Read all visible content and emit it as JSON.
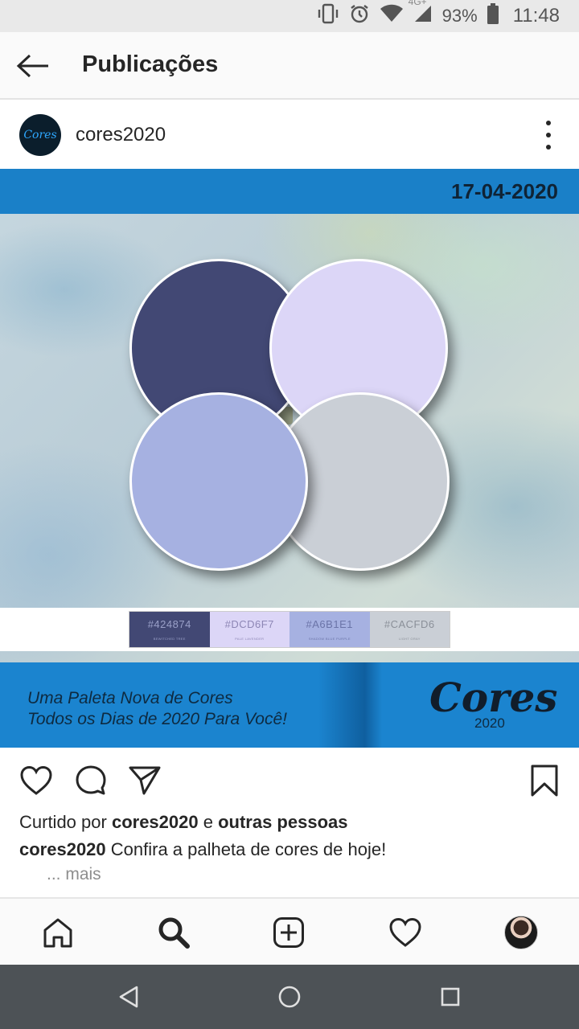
{
  "status_bar": {
    "battery": "93%",
    "time": "11:48",
    "network": "4G+"
  },
  "header": {
    "title": "Publicações"
  },
  "post": {
    "username": "cores2020",
    "avatar_logo_text": "Cores",
    "date": "17-04-2020",
    "palette": [
      {
        "hex": "#424874",
        "name": "BEWITCHED TREE",
        "text_color": "#9aa0c8"
      },
      {
        "hex": "#DCD6F7",
        "name": "PALE LAVENDER",
        "text_color": "#8d86b5"
      },
      {
        "hex": "#A6B1E1",
        "name": "SHADOW BLUE PURPLE",
        "text_color": "#6b74a8"
      },
      {
        "hex": "#CACFD6",
        "name": "LIGHT GRAY",
        "text_color": "#8b9099"
      }
    ],
    "banner": {
      "line1": "Uma Paleta Nova de Cores",
      "line2": "Todos os Dias de 2020 Para Você!",
      "brand": "Cores",
      "brand_year": "2020"
    },
    "liked_by_prefix": "Curtido por ",
    "liked_by_user": "cores2020",
    "liked_by_mid": " e ",
    "liked_by_others": "outras pessoas",
    "caption_user": "cores2020",
    "caption_text": " Confira a palheta de cores de hoje!",
    "more_link": "... mais"
  },
  "colors": {
    "accent_blue": "#1a80c8",
    "text": "#262626",
    "muted": "#8e8e8e"
  }
}
